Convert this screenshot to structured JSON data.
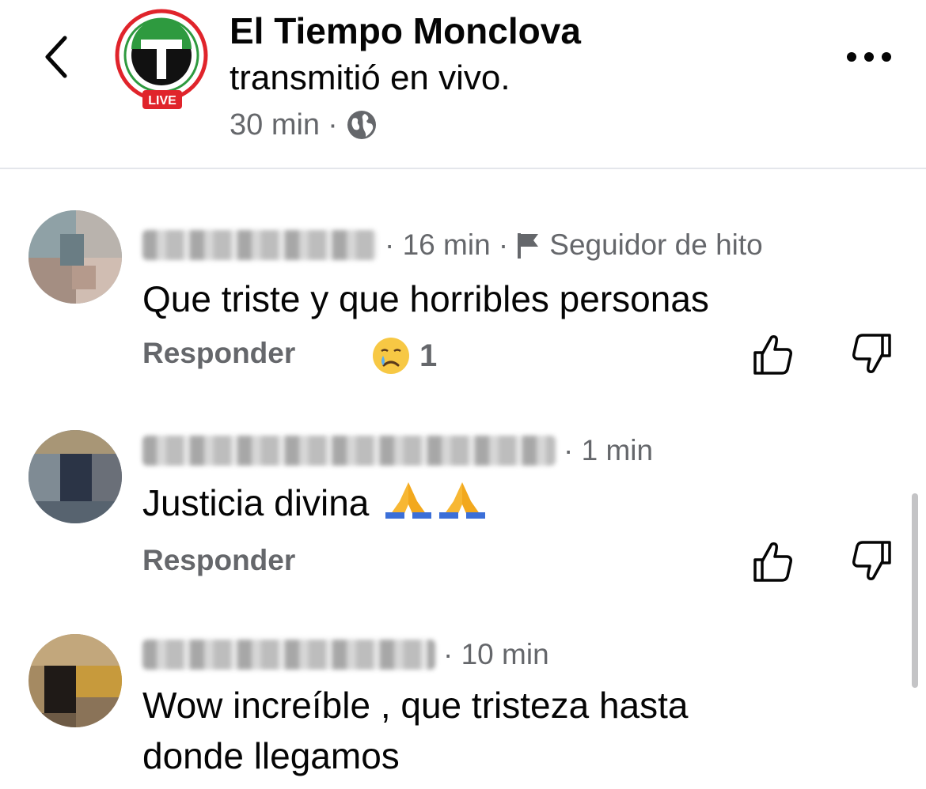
{
  "header": {
    "page_name": "El Tiempo Monclova",
    "action": "transmitió en vivo.",
    "time": "30 min",
    "separator": "·",
    "live_badge": "LIVE",
    "icons": {
      "back": "chevron-left-icon",
      "more": "more-dots-icon",
      "privacy": "globe-icon"
    }
  },
  "comments": [
    {
      "time": "· 16 min ·",
      "badge": "Seguidor de hito",
      "text": "Que triste y que horribles personas",
      "reply_label": "Responder",
      "reaction_count": "1",
      "reaction_icon": "crying-face-emoji"
    },
    {
      "time": "· 1 min",
      "text": "Justicia divina",
      "reply_label": "Responder",
      "emoji": "folded-hands-emoji"
    },
    {
      "time": "· 10 min",
      "text_line1": "Wow increíble , que tristeza hasta",
      "text_line2": "donde llegamos"
    }
  ],
  "colors": {
    "text": "#050505",
    "secondary": "#65676b",
    "live_red": "#e0242b",
    "logo_green": "#2e9a3f"
  }
}
